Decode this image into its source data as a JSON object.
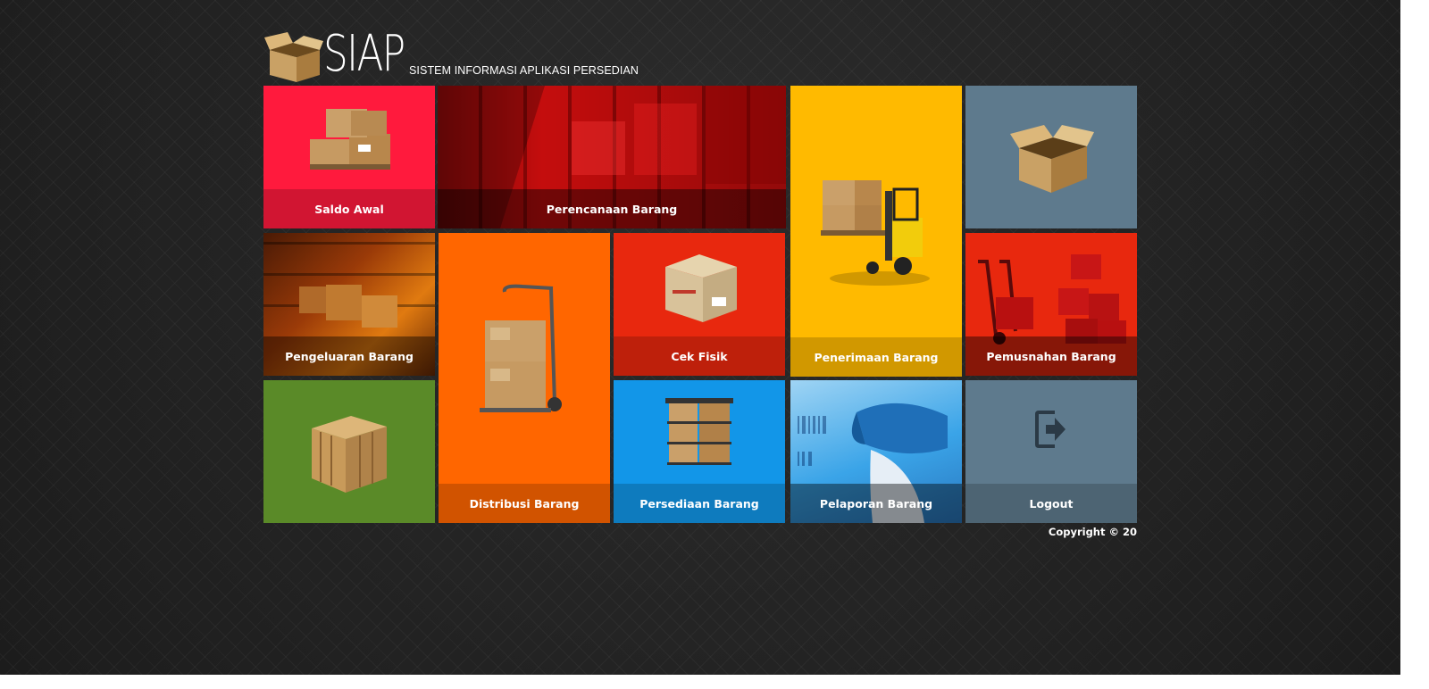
{
  "logo": {
    "title": "SIAP",
    "subtitle": "SISTEM INFORMASI APLIKASI PERSEDIAN"
  },
  "tiles": {
    "saldo_awal": "Saldo Awal",
    "perencanaan": "Perencanaan Barang",
    "penerimaan": "Penerimaan Barang",
    "pengeluaran": "Pengeluaran Barang",
    "distribusi": "Distribusi Barang",
    "cek_fisik": "Cek Fisik",
    "pemusnahan": "Pemusnahan Barang",
    "persediaan": "Persediaan Barang",
    "pelaporan": "Pelaporan Barang",
    "logout": "Logout"
  },
  "footer": {
    "copyright": "Copyright © 20"
  },
  "colors": {
    "red": "#ff1a3d",
    "darkred": "#c2161a",
    "yellow": "#ffba00",
    "slate": "#5e7a8d",
    "orange": "#ff6600",
    "scarlet": "#e8280e",
    "green": "#5a8a28",
    "blue": "#1296e8"
  }
}
